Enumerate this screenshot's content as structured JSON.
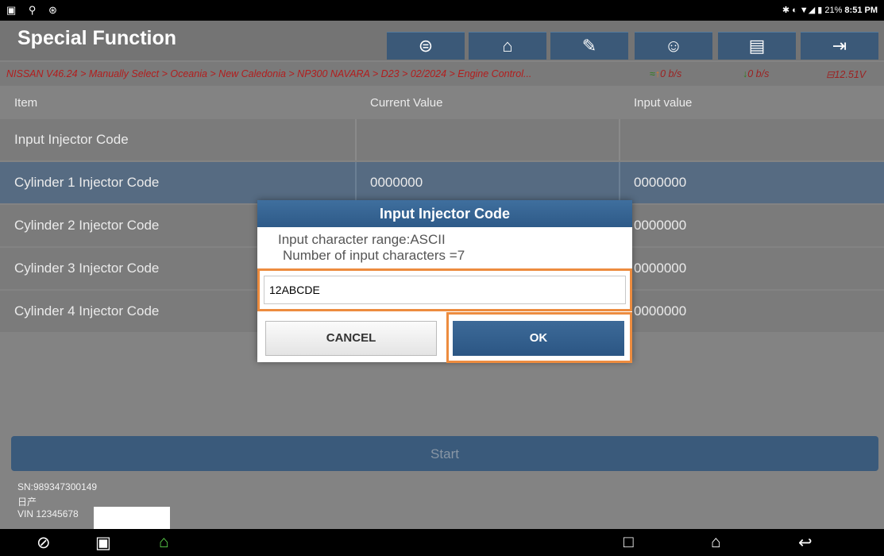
{
  "status": {
    "time": "8:51 PM",
    "battery": "21%"
  },
  "header": {
    "title": "Special Function",
    "toolbar_icons": [
      "steering-icon",
      "home-icon",
      "edit-icon",
      "support-icon",
      "print-icon",
      "exit-icon"
    ]
  },
  "breadcrumb": {
    "path": "NISSAN V46.24 > Manually Select > Oceania > New Caledonia > NP300 NAVARA > D23 > 02/2024 > Engine Control...",
    "upload": "0 b/s",
    "download": "0 b/s",
    "voltage": "12.51V"
  },
  "table": {
    "headers": [
      "Item",
      "Current Value",
      "Input value"
    ],
    "rows": [
      {
        "item": "Input Injector Code",
        "current": "",
        "input": ""
      },
      {
        "item": "Cylinder 1 Injector Code",
        "current": "0000000",
        "input": "0000000"
      },
      {
        "item": "Cylinder 2 Injector Code",
        "current": "",
        "input": "0000000"
      },
      {
        "item": "Cylinder 3 Injector Code",
        "current": "",
        "input": "0000000"
      },
      {
        "item": "Cylinder 4 Injector Code",
        "current": "",
        "input": "0000000"
      }
    ]
  },
  "start_label": "Start",
  "footer": {
    "sn": "SN:989347300149",
    "brand": "日产",
    "vin": "VIN 12345678"
  },
  "dialog": {
    "title": "Input Injector Code",
    "range_text": "Input character range:ASCII",
    "count_text": "Number of input characters =7",
    "input_value": "12ABCDE",
    "cancel_label": "CANCEL",
    "ok_label": "OK"
  },
  "colors": {
    "accent": "#3b5978",
    "highlight": "#ed8c3f",
    "breadcrumb_text": "#b31d1d"
  }
}
